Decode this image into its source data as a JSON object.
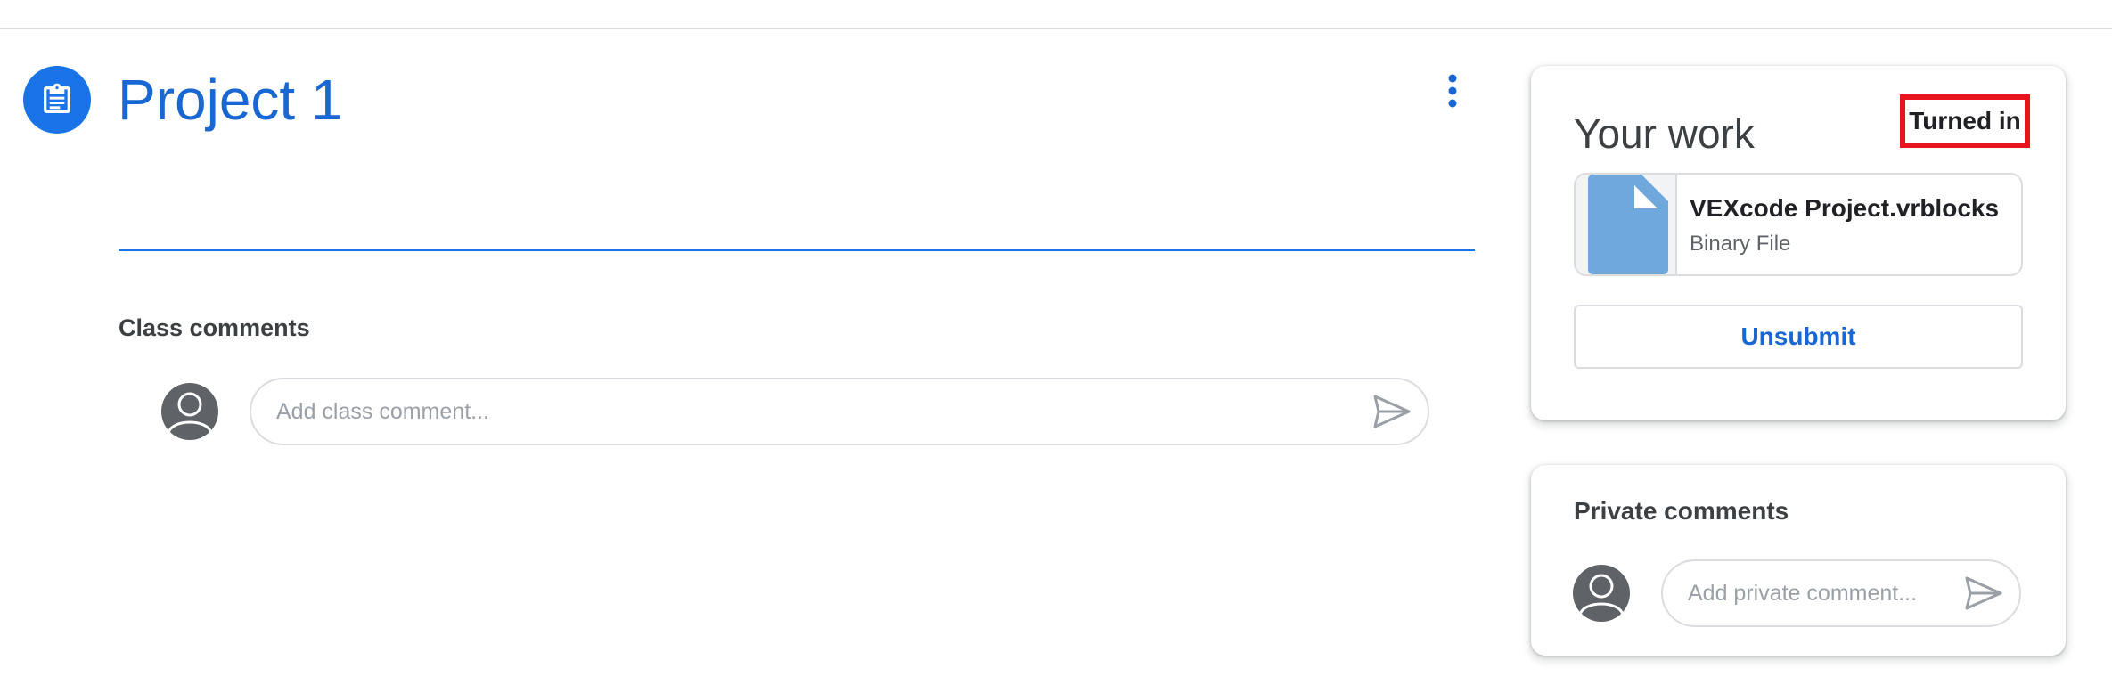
{
  "assignment": {
    "title": "Project 1",
    "icon": "assignment-icon",
    "more_icon": "more-vert-icon",
    "accent_color": "#1a73e8"
  },
  "class_comments": {
    "heading": "Class comments",
    "placeholder": "Add class comment...",
    "send_icon": "send-icon"
  },
  "your_work": {
    "title": "Your work",
    "status": "Turned in",
    "attachment": {
      "name": "VEXcode Project.vrblocks",
      "type": "Binary File",
      "icon": "file-icon"
    },
    "unsubmit_label": "Unsubmit"
  },
  "private_comments": {
    "heading": "Private comments",
    "placeholder": "Add private comment...",
    "send_icon": "send-icon"
  },
  "colors": {
    "status_highlight": "#e8141c",
    "link": "#1967d2",
    "file_icon": "#6fa8dc"
  }
}
